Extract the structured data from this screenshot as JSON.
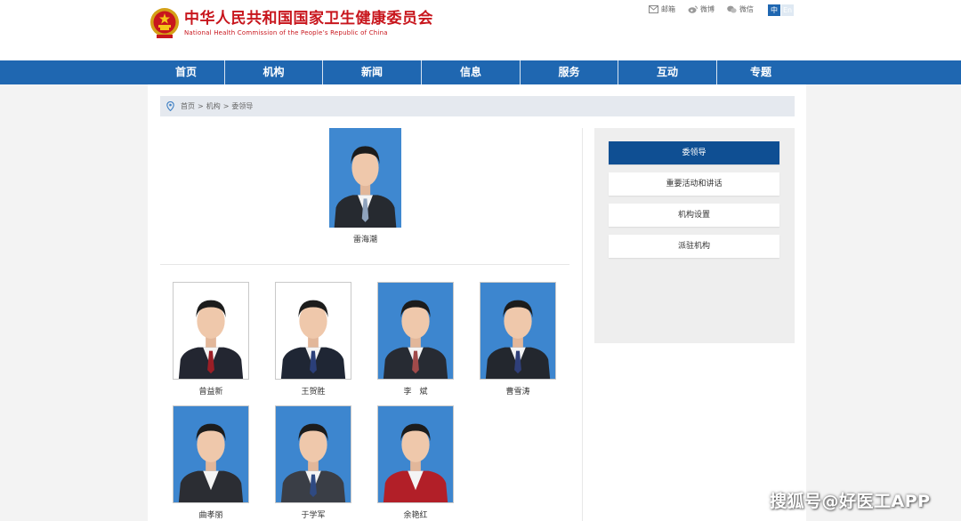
{
  "header": {
    "title_cn": "中华人民共和国国家卫生健康委员会",
    "title_en": "National Health Commission of the People’s Republic of China",
    "links": [
      {
        "label": "邮箱",
        "icon": "mail-icon"
      },
      {
        "label": "微博",
        "icon": "weibo-icon"
      },
      {
        "label": "微信",
        "icon": "wechat-icon"
      }
    ],
    "lang": {
      "zh": "中",
      "en": "En"
    }
  },
  "nav": {
    "items": [
      {
        "label": "首页"
      },
      {
        "label": "机构"
      },
      {
        "label": "新闻"
      },
      {
        "label": "信息"
      },
      {
        "label": "服务"
      },
      {
        "label": "互动"
      },
      {
        "label": "专题"
      }
    ]
  },
  "breadcrumb": {
    "icon": "location-pin-icon",
    "items": [
      "首页",
      "机构",
      "委领导"
    ],
    "separator": ">"
  },
  "leaders": {
    "head": {
      "name": "雷海潮",
      "backdrop": "#3f88d0",
      "jacket": "#262a30",
      "tie": "#8fa3bd"
    },
    "members": [
      {
        "name": "曾益新",
        "backdrop": "#ffffff",
        "jacket": "#232631",
        "tie": "#9b1e26"
      },
      {
        "name": "王贺胜",
        "backdrop": "#ffffff",
        "jacket": "#1f2634",
        "tie": "#2b3f79"
      },
      {
        "name": "李　斌",
        "backdrop": "#3d86cf",
        "jacket": "#272b33",
        "tie": "#a04a4a"
      },
      {
        "name": "曹雪涛",
        "backdrop": "#3d86cf",
        "jacket": "#23272e",
        "tie": "#2f3f7a"
      },
      {
        "name": "曲孝丽",
        "backdrop": "#3d86cf",
        "jacket": "#2b2d33",
        "tie": ""
      },
      {
        "name": "于学军",
        "backdrop": "#3d86cf",
        "jacket": "#3a3e46",
        "tie": "#2f4a82"
      },
      {
        "name": "余艳红",
        "backdrop": "#3d86cf",
        "jacket": "#b21f28",
        "tie": ""
      }
    ]
  },
  "sidebar": {
    "items": [
      {
        "label": "委领导",
        "active": true
      },
      {
        "label": "重要活动和讲话",
        "active": false
      },
      {
        "label": "机构设置",
        "active": false
      },
      {
        "label": "派驻机构",
        "active": false
      }
    ]
  },
  "colors": {
    "brand_red": "#c8161d",
    "nav_blue": "#1f67b1",
    "active_blue": "#0f4f93"
  },
  "watermark": "搜狐号@好医工APP"
}
